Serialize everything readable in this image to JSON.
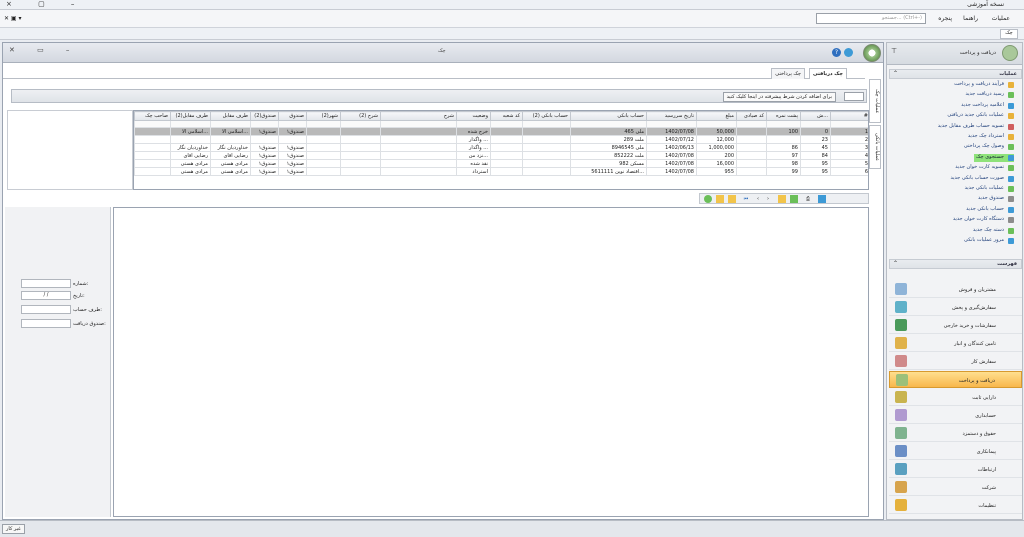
{
  "titlebar": {
    "title": "نسخه آموزشی",
    "controls": "× ▢ –",
    "left_tools": "✕ ▣ ▾"
  },
  "menubar": {
    "search_placeholder": "جستجو... (Ctrl+-)",
    "items": [
      "عملیات",
      "راهنما",
      "پنجره"
    ]
  },
  "tabstrip": {
    "tab": "چک"
  },
  "window": {
    "caption": "چک",
    "controls": "✕ ▭ –",
    "help": "?"
  },
  "subtabs": [
    {
      "label": "چک دریافتی",
      "active": true
    },
    {
      "label": "چک پرداختی",
      "active": false
    }
  ],
  "filterbar": {
    "button": "برای اضافه کردن شرط پیشرفته در اینجا کلیک کنید"
  },
  "vtabs": [
    "عملیات چک",
    "عملیات بانکی"
  ],
  "grid": {
    "headers": [
      "صاحب چک",
      "طرف مقابل(2)",
      "طرف مقابل",
      "صندوق(2)",
      "صندوق",
      "شهر(2)",
      "شرح (2)",
      "شرح",
      "وضعیت",
      "کد شعبه",
      "حساب بانکی (2)",
      "حساب بانکی",
      "تاریخ سررسید",
      "مبلغ",
      "کد صیادی",
      "پشت نمره",
      "ش...",
      "#"
    ],
    "rows": [
      [
        "",
        "اسلامی الا...",
        "اسلامی الا...",
        "صندوق۱",
        "صندوق۱",
        "",
        "",
        "",
        "خرج شده",
        "",
        "",
        "ملی 465",
        "1402/07/08",
        "50,000",
        "",
        "100",
        "0",
        "1"
      ],
      [
        "",
        "",
        "",
        "",
        "",
        "",
        "",
        "",
        "واگذار ...",
        "",
        "",
        "ملت 289",
        "1402/07/12",
        "12,000",
        "",
        "",
        "23",
        "2"
      ],
      [
        "",
        "خداوردیان نگار",
        "خداوردیان نگار",
        "صندوق۱",
        "صندوق۱",
        "",
        "",
        "",
        "واگذار ...",
        "",
        "",
        "ملی 8946545",
        "1402/06/13",
        "1,000,000",
        "",
        "86",
        "45",
        "3"
      ],
      [
        "",
        "رضایی اقای",
        "رضایی اقای",
        "صندوق۱",
        "صندوق۱",
        "",
        "",
        "",
        "نزد من...",
        "",
        "",
        "ملت 852222",
        "1402/07/08",
        "200",
        "",
        "97",
        "84",
        "4"
      ],
      [
        "",
        "مرادی هستی",
        "مرادی هستی",
        "صندوق۱",
        "صندوق۱",
        "",
        "",
        "",
        "نقد شده",
        "",
        "",
        "مسکن 982",
        "1402/07/08",
        "16,000",
        "",
        "98",
        "95",
        "5"
      ],
      [
        "",
        "مرادی هستی",
        "مرادی هستی",
        "صندوق۱",
        "صندوق۱",
        "",
        "",
        "",
        "استرداد",
        "",
        "",
        "اقتصاد نوین 5611111...",
        "1402/07/08",
        "955",
        "",
        "99",
        "95",
        "6"
      ]
    ]
  },
  "detail": {
    "labels": [
      "شماره:",
      "تاریخ:",
      "طرف حساب:",
      "صندوق دریافت:"
    ],
    "date_value": "/ /"
  },
  "rightpanel": {
    "title": "دریافت و پرداخت",
    "ops_title": "عملیات",
    "list_title": "فهرست",
    "operations": [
      "فرآیند دریافت و پرداخت",
      "رسید دریافت جدید",
      "اعلامیه پرداخت جدید",
      "عملیات بانکی جدید دریافتی",
      "تسویه حساب طرف مقابل جدید",
      "استرداد چک جدید",
      "وصول چک پرداختی",
      "جستجوی چک",
      "تسویه کارت خوان جدید",
      "صورت حساب بانکی جدید",
      "عملیات بانکی جدید",
      "صندوق جدید",
      "حساب بانکی جدید",
      "دستگاه کارت خوان جدید",
      "دسته چک جدید",
      "مرور عملیات بانکی"
    ],
    "highlighted": "جستجوی چک",
    "modules": [
      "مشتریان و فروش",
      "سفارش‌گیری و پخش",
      "سفارشات و خرید خارجی",
      "تامین کنندگان و انبار",
      "سفارش کار",
      "دریافت و پرداخت",
      "دارایی ثابت",
      "حسابداری",
      "حقوق و دستمزد",
      "پیمانکاری",
      "ارتباطات",
      "شرکت",
      "تنظیمات"
    ],
    "active_module": "دریافت و پرداخت",
    "module_colors": [
      "#8fb4d8",
      "#5fb1c9",
      "#4a9a5a",
      "#e0b24a",
      "#d08a8a",
      "#9cc07a",
      "#c9b44f",
      "#b09ad0",
      "#7fb38f",
      "#6b8fc6",
      "#5aa0c0",
      "#d7a44d",
      "#e5b13c"
    ]
  },
  "statusbar": {
    "text": "غیر کار"
  }
}
